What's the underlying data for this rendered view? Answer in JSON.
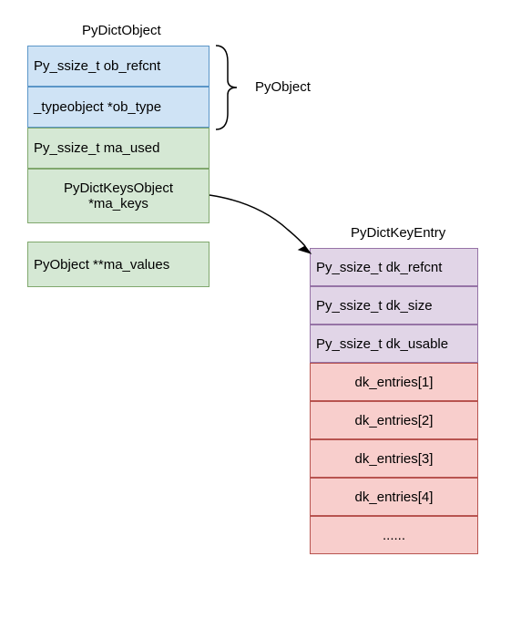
{
  "left_title": "PyDictObject",
  "right_title": "PyDictKeyEntry",
  "brace_label": "PyObject",
  "left_fields": [
    "Py_ssize_t ob_refcnt",
    "_typeobject *ob_type",
    "Py_ssize_t ma_used",
    "PyDictKeysObject *ma_keys",
    "PyObject **ma_values"
  ],
  "right_fields": [
    "Py_ssize_t dk_refcnt",
    "Py_ssize_t dk_size",
    "Py_ssize_t dk_usable",
    "dk_entries[1]",
    "dk_entries[2]",
    "dk_entries[3]",
    "dk_entries[4]",
    "......"
  ],
  "chart_data": {
    "type": "diagram",
    "structures": [
      {
        "name": "PyDictObject",
        "fields": [
          {
            "label": "Py_ssize_t ob_refcnt",
            "group": "PyObject"
          },
          {
            "label": "_typeobject *ob_type",
            "group": "PyObject"
          },
          {
            "label": "Py_ssize_t ma_used"
          },
          {
            "label": "PyDictKeysObject *ma_keys",
            "points_to": "PyDictKeyEntry"
          },
          {
            "label": "PyObject **ma_values"
          }
        ]
      },
      {
        "name": "PyDictKeyEntry",
        "fields": [
          {
            "label": "Py_ssize_t dk_refcnt"
          },
          {
            "label": "Py_ssize_t dk_size"
          },
          {
            "label": "Py_ssize_t dk_usable"
          },
          {
            "label": "dk_entries[1]"
          },
          {
            "label": "dk_entries[2]"
          },
          {
            "label": "dk_entries[3]"
          },
          {
            "label": "dk_entries[4]"
          },
          {
            "label": "......"
          }
        ]
      }
    ],
    "groups": [
      {
        "name": "PyObject",
        "covers": [
          "Py_ssize_t ob_refcnt",
          "_typeobject *ob_type"
        ]
      }
    ],
    "arrows": [
      {
        "from": "PyDictKeysObject *ma_keys",
        "to": "PyDictKeyEntry"
      }
    ]
  }
}
